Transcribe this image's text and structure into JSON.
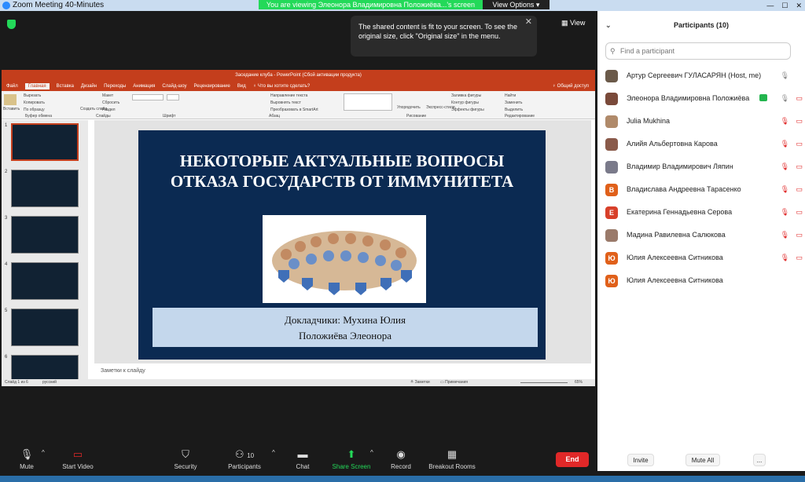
{
  "window": {
    "title": "Zoom Meeting 40-Minutes",
    "controls": [
      "—",
      "☐",
      "✕"
    ]
  },
  "banner": {
    "text": "You are viewing Элеонора Владимировна Положиёва...'s screen",
    "view_options": "View Options ▾"
  },
  "tooltip": {
    "text": "The shared content is fit to your screen. To see the original size, click \"Original size\" in the menu.",
    "close": "✕"
  },
  "view_button": {
    "label": "▦ View"
  },
  "powerpoint": {
    "title": "Заседание клуба - PowerPoint (Сбой активации продукта)",
    "tabs": [
      "Файл",
      "Главная",
      "Вставка",
      "Дизайн",
      "Переходы",
      "Анимация",
      "Слайд-шоу",
      "Рецензирование",
      "Вид",
      "♀ Что вы хотите сделать?"
    ],
    "share_btn": "♀ Общий доступ",
    "ribbon": {
      "insert": "Вставить",
      "cut": "Вырезать",
      "copy": "Копировать",
      "format": "По образцу",
      "create_slide": "Создать слайд",
      "layout": "Макет",
      "reset": "Сбросить",
      "section": "Раздел",
      "text_dir": "Направление текста",
      "align": "Выровнять текст",
      "smartart": "Преобразовать в SmartArt",
      "arrange": "Упорядочить",
      "quick_styles": "Экспресс-стили",
      "fill": "Заливка фигуры",
      "outline": "Контур фигуры",
      "effects": "Эффекты фигуры",
      "find": "Найти",
      "replace": "Заменить",
      "select": "Выделить",
      "g_clipboard": "Буфер обмена",
      "g_slides": "Слайды",
      "g_font": "Шрифт",
      "g_para": "Абзац",
      "g_draw": "Рисование",
      "g_edit": "Редактирование"
    },
    "thumb_numbers": [
      "1",
      "2",
      "3",
      "4",
      "5",
      "6"
    ],
    "slide": {
      "title": "НЕКОТОРЫЕ АКТУАЛЬНЫЕ ВОПРОСЫ ОТКАЗА ГОСУДАРСТВ ОТ ИММУНИТЕТА",
      "speakers_line1": "Докладчики: Мухина Юлия",
      "speakers_line2": "Положиёва Элеонора"
    },
    "notes": "Заметки к слайду",
    "status": {
      "slide": "Слайд 1 из 6",
      "lang": "русский",
      "notes": "≙ Заметки",
      "comments": "▭ Примечания",
      "zoom": "65%"
    }
  },
  "panel": {
    "title": "Participants (10)",
    "search_placeholder": "Find a participant",
    "participants": [
      {
        "name": "Артур Сергеевич ГУЛАСАРЯН (Host, me)",
        "initial": "",
        "color": "#6b5a4a",
        "mic": "🎙",
        "cam": "",
        "muted": false
      },
      {
        "name": "Элеонора Владимировна Положиёва",
        "initial": "",
        "color": "#7a4a3a",
        "mic": "🎙",
        "cam": "▭",
        "muted": false
      },
      {
        "name": "Julia Mukhina",
        "initial": "",
        "color": "#b08a6a",
        "mic": "🎙",
        "cam": "▭",
        "muted": true
      },
      {
        "name": "Алийя Альбертовна Карова",
        "initial": "",
        "color": "#8a5a4a",
        "mic": "🎙",
        "cam": "▭",
        "muted": true
      },
      {
        "name": "Владимир Владимирович Ляпин",
        "initial": "",
        "color": "#7a7a8a",
        "mic": "🎙",
        "cam": "▭",
        "muted": true
      },
      {
        "name": "Владислава Андреевна Тарасенко",
        "initial": "В",
        "color": "#e0601a",
        "mic": "🎙",
        "cam": "▭",
        "muted": true
      },
      {
        "name": "Екатерина Геннадьевна Серова",
        "initial": "Е",
        "color": "#d8402a",
        "mic": "🎙",
        "cam": "▭",
        "muted": true
      },
      {
        "name": "Мадина Равилевна Салюкова",
        "initial": "",
        "color": "#9a7a6a",
        "mic": "🎙",
        "cam": "▭",
        "muted": true
      },
      {
        "name": "Юлия Алексеевна Ситникова",
        "initial": "Ю",
        "color": "#e0601a",
        "mic": "🎙",
        "cam": "▭",
        "muted": true
      },
      {
        "name": "Юлия Алексеевна Ситникова",
        "initial": "Ю",
        "color": "#e0601a",
        "mic": "",
        "cam": "",
        "muted": true
      }
    ],
    "invite": "Invite",
    "mute_all": "Mute All",
    "more": "..."
  },
  "toolbar": {
    "mute": "Mute",
    "start_video": "Start Video",
    "security": "Security",
    "participants": "Participants",
    "participants_count": "10",
    "chat": "Chat",
    "share_screen": "Share Screen",
    "record": "Record",
    "breakout": "Breakout Rooms",
    "end": "End"
  }
}
